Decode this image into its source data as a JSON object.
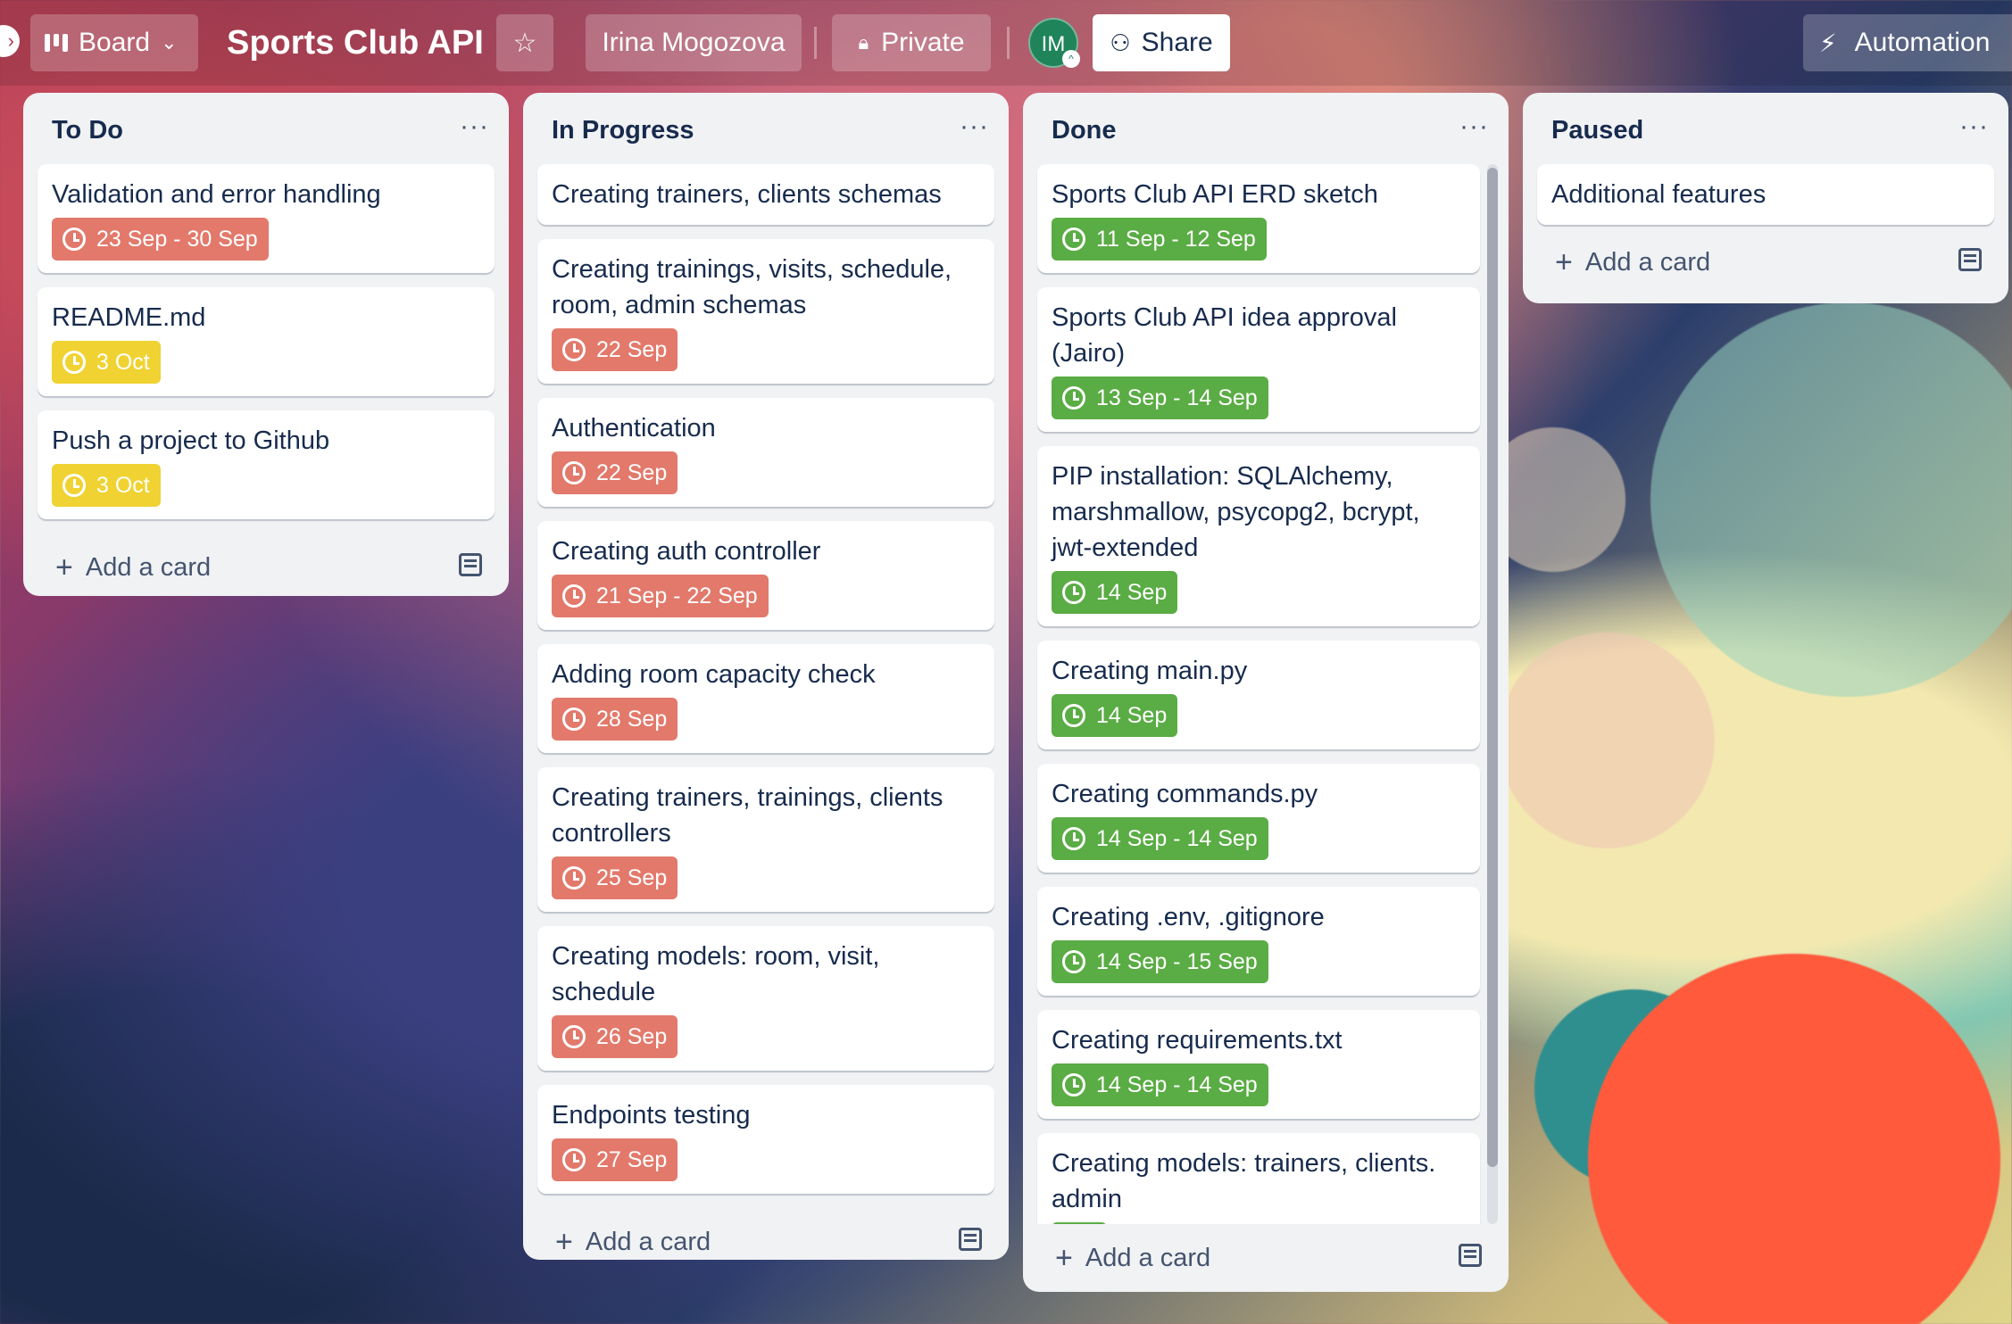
{
  "header": {
    "view_label": "Board",
    "board_title": "Sports Club API",
    "owner": "Irina Mogozova",
    "visibility": "Private",
    "avatar_initials": "IM",
    "share_label": "Share",
    "automation_label": "Automation"
  },
  "add_card_label": "Add a card",
  "colors": {
    "red": "#e2796b",
    "yellow": "#f0d232",
    "green": "#5aac44"
  },
  "lists": [
    {
      "title": "To Do",
      "cards": [
        {
          "title": "Validation and error handling",
          "due": "23 Sep - 30 Sep",
          "status": "red"
        },
        {
          "title": "README.md",
          "due": "3 Oct",
          "status": "yellow"
        },
        {
          "title": "Push a project to Github",
          "due": "3 Oct",
          "status": "yellow"
        }
      ]
    },
    {
      "title": "In Progress",
      "cards": [
        {
          "title": "Creating trainers, clients schemas",
          "due": "",
          "status": ""
        },
        {
          "title": "Creating trainings, visits, schedule, room, admin schemas",
          "due": "22 Sep",
          "status": "red"
        },
        {
          "title": "Authentication",
          "due": "22 Sep",
          "status": "red"
        },
        {
          "title": "Creating auth controller",
          "due": "21 Sep - 22 Sep",
          "status": "red"
        },
        {
          "title": "Adding room capacity check",
          "due": "28 Sep",
          "status": "red"
        },
        {
          "title": "Creating trainers, trainings, clients controllers",
          "due": "25 Sep",
          "status": "red"
        },
        {
          "title": "Creating models: room, visit, schedule",
          "due": "26 Sep",
          "status": "red"
        },
        {
          "title": "Endpoints testing",
          "due": "27 Sep",
          "status": "red"
        }
      ]
    },
    {
      "title": "Done",
      "cards": [
        {
          "title": "Sports Club API ERD sketch",
          "due": "11 Sep - 12 Sep",
          "status": "green"
        },
        {
          "title": "Sports Club API idea approval (Jairo)",
          "due": "13 Sep - 14 Sep",
          "status": "green"
        },
        {
          "title": "PIP installation: SQLAlchemy, marshmallow, psycopg2, bcrypt, jwt-extended",
          "due": "14 Sep",
          "status": "green"
        },
        {
          "title": "Creating main.py",
          "due": "14 Sep",
          "status": "green"
        },
        {
          "title": "Creating commands.py",
          "due": "14 Sep - 14 Sep",
          "status": "green"
        },
        {
          "title": "Creating .env, .gitignore",
          "due": "14 Sep - 15 Sep",
          "status": "green"
        },
        {
          "title": "Creating requirements.txt",
          "due": "14 Sep - 14 Sep",
          "status": "green"
        },
        {
          "title": "Creating models: trainers, clients. admin",
          "due": "",
          "status": "green"
        }
      ]
    },
    {
      "title": "Paused",
      "cards": [
        {
          "title": "Additional features",
          "due": "",
          "status": ""
        }
      ]
    }
  ]
}
